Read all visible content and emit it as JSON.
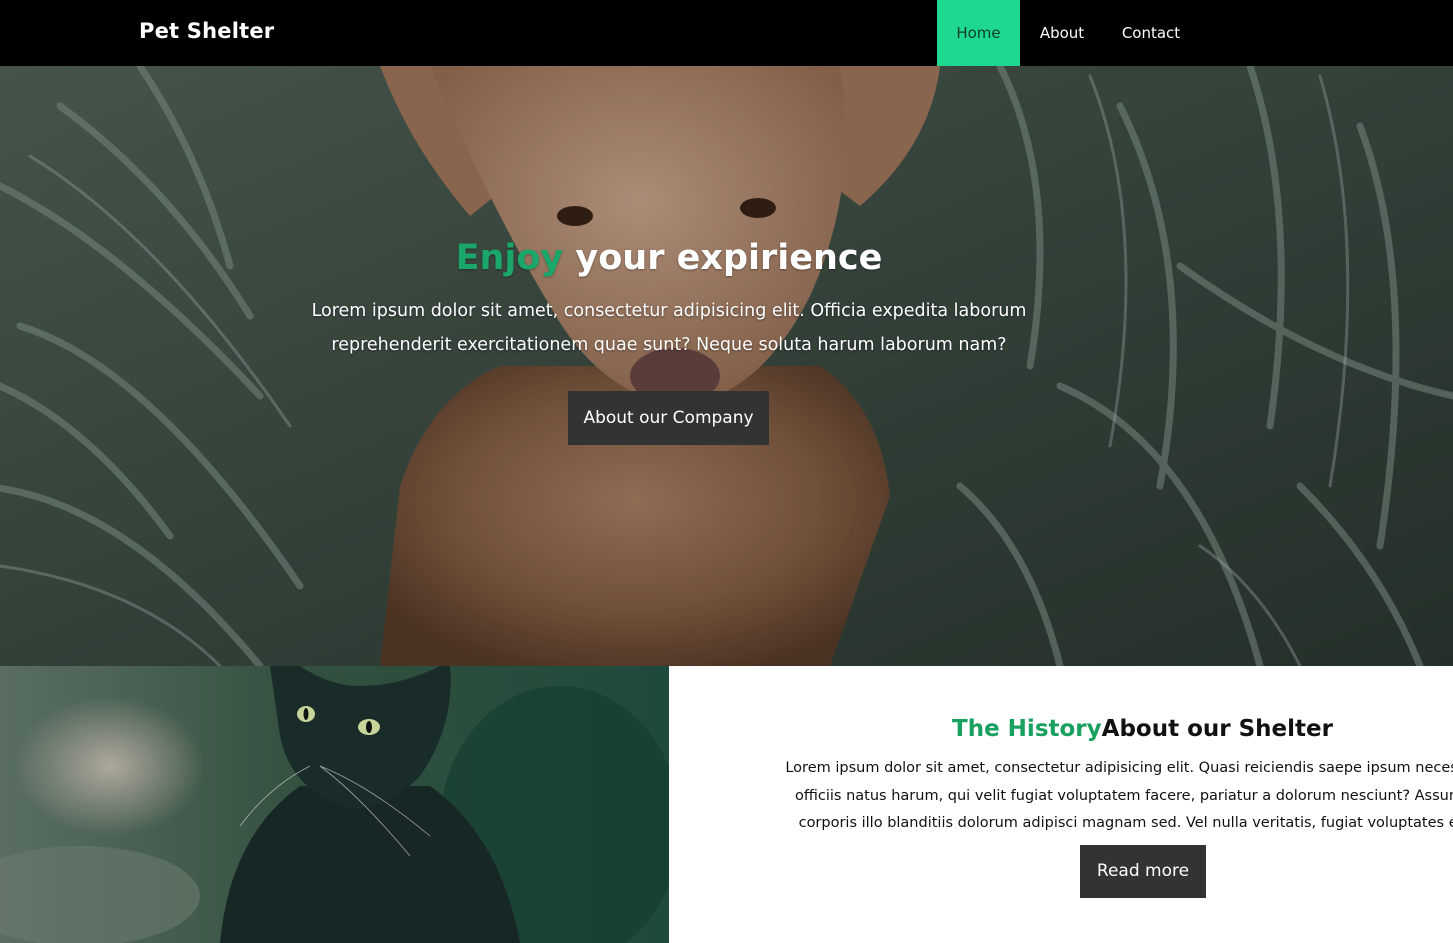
{
  "navbar": {
    "brand": "Pet Shelter",
    "items": [
      {
        "label": "Home"
      },
      {
        "label": "About"
      },
      {
        "label": "Contact"
      }
    ],
    "active_color": "#1dd88e"
  },
  "hero": {
    "title_accent": "Enjoy",
    "title_rest": " your expirience",
    "text": "Lorem ipsum dolor sit amet, consectetur adipisicing elit. Officia expedita laborum reprehenderit exercitationem quae sunt? Neque soluta harum laborum nam?",
    "button_label": "About our Company"
  },
  "history": {
    "title_accent": "The History",
    "title_rest": "About our Shelter",
    "lines": [
      "Lorem ipsum dolor sit amet, consectetur adipisicing elit. Quasi reiciendis saepe ipsum necessitatibus quibus",
      "officiis natus harum, qui velit fugiat voluptatem facere, pariatur a dolorum nesciunt? Assumenda unde no",
      "corporis illo blanditiis dolorum adipisci magnam sed. Vel nulla veritatis, fugiat voluptates est vitae ipsa e"
    ],
    "button_label": "Read more"
  },
  "colors": {
    "accent": "#17a05e",
    "button_bg": "#333333",
    "navbar_bg": "#000000"
  }
}
